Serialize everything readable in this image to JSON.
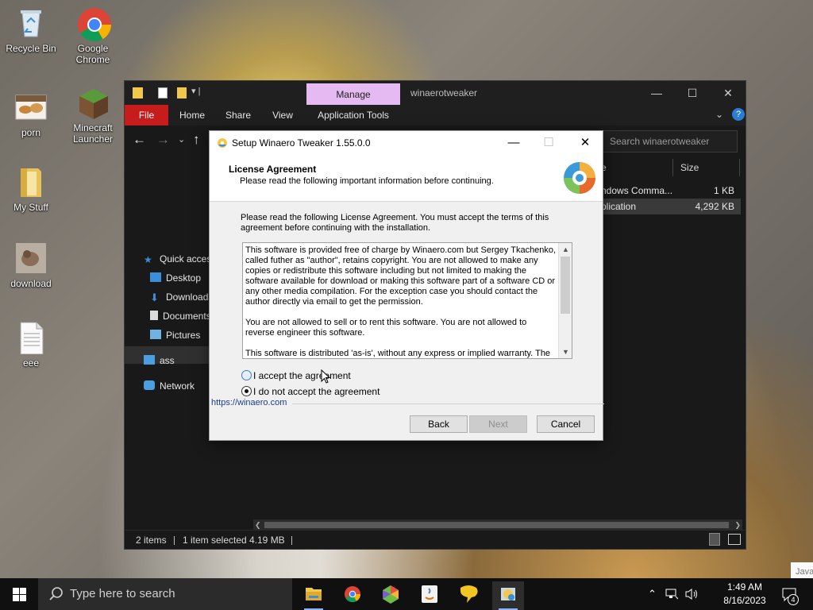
{
  "desktop": {
    "icons": [
      {
        "label": "Recycle Bin"
      },
      {
        "label": "Google Chrome"
      },
      {
        "label": "porn"
      },
      {
        "label": "Minecraft Launcher"
      },
      {
        "label": "My Stuff"
      },
      {
        "label": "download"
      },
      {
        "label": "eee"
      }
    ]
  },
  "explorer": {
    "manage_tab": "Manage",
    "title": "winaerotweaker",
    "ribbon": {
      "file": "File",
      "home": "Home",
      "share": "Share",
      "view": "View",
      "app_tools": "Application Tools"
    },
    "search_placeholder": "Search winaerotweaker",
    "nav": {
      "quick_access": "Quick access",
      "desktop": "Desktop",
      "downloads": "Downloads",
      "documents": "Documents",
      "pictures": "Pictures",
      "ass": "ass",
      "network": "Network"
    },
    "columns": {
      "name_partial": "e",
      "size": "Size"
    },
    "files": [
      {
        "name": "ndows Comma...",
        "size": "1 KB"
      },
      {
        "name": "plication",
        "size": "4,292 KB"
      }
    ],
    "status": {
      "items": "2 items",
      "selected": "1 item selected",
      "size": "4.19 MB"
    }
  },
  "setup": {
    "title": "Setup Winaero Tweaker 1.55.0.0",
    "header_title": "License Agreement",
    "header_subtitle": "Please read the following important information before continuing.",
    "intro": "Please read the following License Agreement. You must accept the terms of this agreement before continuing with the installation.",
    "license_paragraphs": [
      "This software is provided free of charge by Winaero.com but Sergey Tkachenko, called futher as \"author\", retains copyright. You are not allowed to make any copies or redistribute this software including but not limited to making the software available for download or making this software part of a software CD or any other media compilation. For the exception case you should contact the author directly via email to get the permission.",
      "You are not allowed to sell or to rent this software. You are not allowed to reverse engineer this software.",
      "This software is distributed 'as-is', without any express or implied warranty. The"
    ],
    "accept_label": "I accept the agreement",
    "decline_label": "I do not accept the agreement",
    "link": "https://winaero.com",
    "back": "Back",
    "next": "Next",
    "cancel": "Cancel"
  },
  "taskbar": {
    "search_placeholder": "Type here to search",
    "time": "1:49 AM",
    "date": "8/16/2023",
    "notification_count": "4"
  },
  "toast_partial": "Java"
}
